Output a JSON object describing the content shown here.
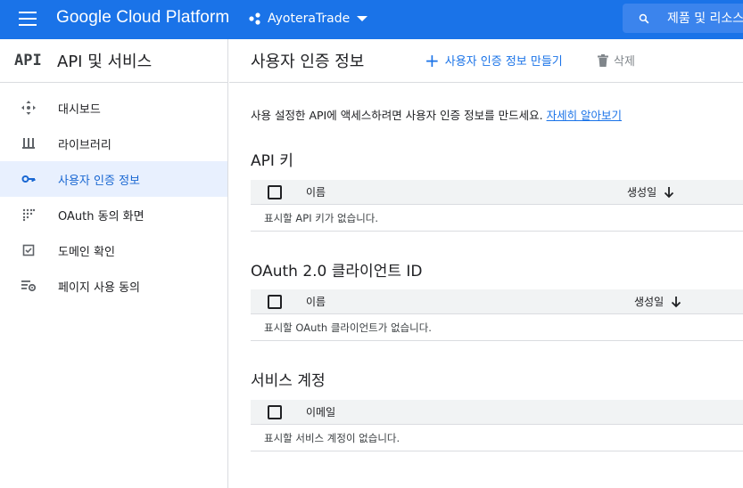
{
  "topbar": {
    "brand": "Google Cloud Platform",
    "project_name": "AyoteraTrade",
    "search_placeholder": "제품 및 리소스 검색"
  },
  "sidebar": {
    "logo_text": "API",
    "title": "API 및 서비스",
    "items": [
      {
        "label": "대시보드",
        "icon": "dashboard-icon",
        "active": false
      },
      {
        "label": "라이브러리",
        "icon": "library-icon",
        "active": false
      },
      {
        "label": "사용자 인증 정보",
        "icon": "key-icon",
        "active": true
      },
      {
        "label": "OAuth 동의 화면",
        "icon": "oauth-consent-icon",
        "active": false
      },
      {
        "label": "도메인 확인",
        "icon": "domain-verify-icon",
        "active": false
      },
      {
        "label": "페이지 사용 동의",
        "icon": "page-usage-icon",
        "active": false
      }
    ]
  },
  "main": {
    "title": "사용자 인증 정보",
    "create_label": "사용자 인증 정보 만들기",
    "delete_label": "삭제",
    "intro_text": "사용 설정한 API에 액세스하려면 사용자 인증 정보를 만드세요.",
    "intro_link": "자세히 알아보기",
    "sections": [
      {
        "title": "API 키",
        "col_name": "이름",
        "col_date": "생성일",
        "empty": "표시할 API 키가 없습니다."
      },
      {
        "title": "OAuth 2.0 클라이언트 ID",
        "col_name": "이름",
        "col_date": "생성일",
        "empty": "표시할 OAuth 클라이언트가 없습니다."
      },
      {
        "title": "서비스 계정",
        "col_name": "이메일",
        "col_date": "",
        "empty": "표시할 서비스 계정이 없습니다."
      }
    ]
  },
  "colors": {
    "brand_blue": "#1a73e8",
    "active_bg": "#e8f0fe",
    "active_text": "#1967d2"
  }
}
